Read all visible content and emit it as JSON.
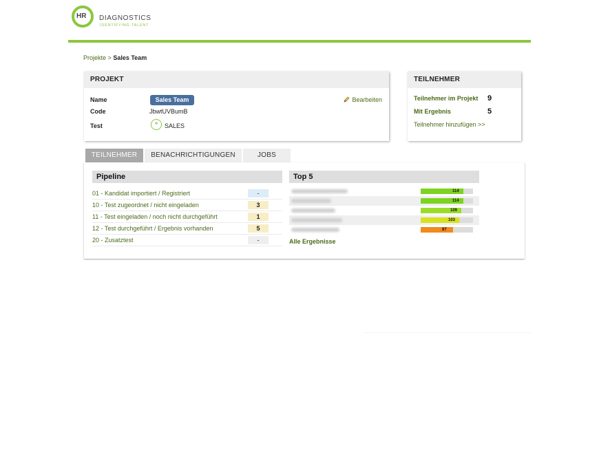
{
  "logo": {
    "hr": "HR",
    "name": "DIAGNOSTICS",
    "tagline": "IDENTIFYING TALENT"
  },
  "breadcrumb": {
    "parent": "Projekte",
    "separator": ">",
    "current": "Sales Team"
  },
  "projekt": {
    "title": "PROJEKT",
    "name_label": "Name",
    "name_value": "Sales Team",
    "code_label": "Code",
    "code_value": "JbwtUVBumB",
    "test_label": "Test",
    "test_value": "SALES",
    "edit_label": "Bearbeiten"
  },
  "teilnehmer": {
    "title": "TEILNEHMER",
    "im_projekt_label": "Teilnehmer im Projekt",
    "im_projekt_value": "9",
    "mit_ergebnis_label": "Mit Ergebnis",
    "mit_ergebnis_value": "5",
    "add_link": "Teilnehmer hinzufügen >>"
  },
  "tabs": [
    {
      "label": "TEILNEHMER",
      "active": true
    },
    {
      "label": "BENACHRICHTIGUNGEN",
      "active": false
    },
    {
      "label": "JOBS",
      "active": false
    }
  ],
  "pipeline": {
    "title": "Pipeline",
    "rows": [
      {
        "label": "01 - Kandidat importiert / Registriert",
        "count": "-",
        "color": "#dcecf8"
      },
      {
        "label": "10 - Test zugeordnet / nicht eingeladen",
        "count": "3",
        "color": "#f7edc6"
      },
      {
        "label": "11 - Test eingeladen / noch nicht durchgeführt",
        "count": "1",
        "color": "#f7edc6"
      },
      {
        "label": "12 - Test durchgeführt / Ergebnis vorhanden",
        "count": "5",
        "color": "#f7edc6"
      },
      {
        "label": "20 - Zusatztest",
        "count": "-",
        "color": "#eeeeee"
      }
    ]
  },
  "top5": {
    "title": "Top 5",
    "rows": [
      {
        "score": 114,
        "color": "#7ed321"
      },
      {
        "score": 114,
        "color": "#7ed321"
      },
      {
        "score": 109,
        "color": "#9bdc2a"
      },
      {
        "score": 103,
        "color": "#d7e11f"
      },
      {
        "score": 87,
        "color": "#f08a1c"
      }
    ],
    "max_score": 140,
    "all_results": "Alle Ergebnisse"
  }
}
